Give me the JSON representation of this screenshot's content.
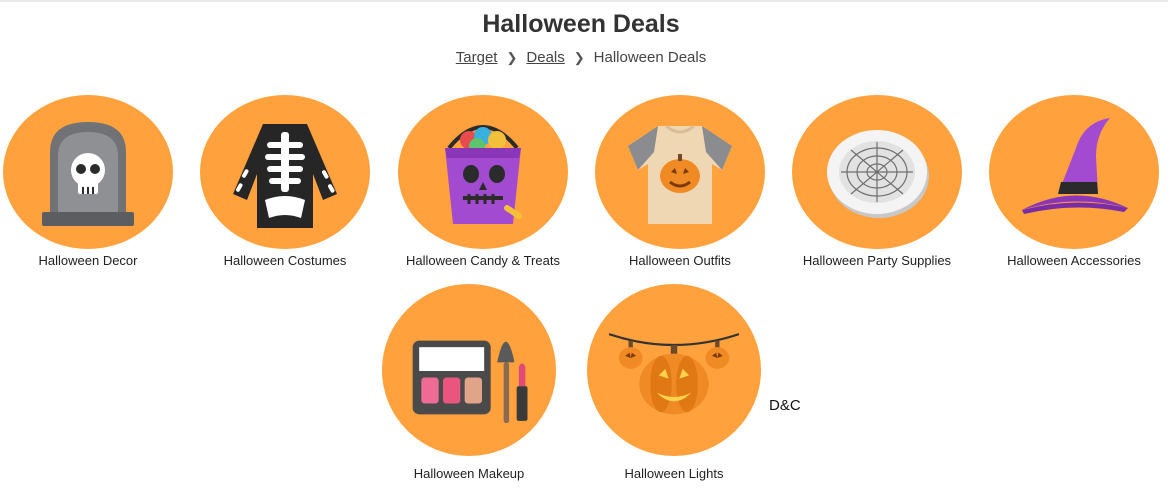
{
  "page": {
    "title": "Halloween Deals"
  },
  "breadcrumb": {
    "items": [
      "Target",
      "Deals"
    ],
    "current": "Halloween Deals"
  },
  "categories": [
    {
      "label": "Halloween Decor",
      "icon": "tombstone-icon"
    },
    {
      "label": "Halloween Costumes",
      "icon": "skeleton-shirt-icon"
    },
    {
      "label": "Halloween Candy & Treats",
      "icon": "candy-bucket-icon"
    },
    {
      "label": "Halloween Outfits",
      "icon": "pumpkin-tshirt-icon"
    },
    {
      "label": "Halloween Party Supplies",
      "icon": "spiderweb-plate-icon"
    },
    {
      "label": "Halloween Accessories",
      "icon": "witch-hat-icon"
    },
    {
      "label": "Halloween Makeup",
      "icon": "makeup-palette-icon"
    },
    {
      "label": "Halloween Lights",
      "icon": "pumpkin-lights-icon"
    }
  ],
  "footer_mark": "D&C",
  "colors": {
    "accent_orange": "#ffa13d",
    "text": "#333333",
    "purple": "#a24bd1"
  }
}
